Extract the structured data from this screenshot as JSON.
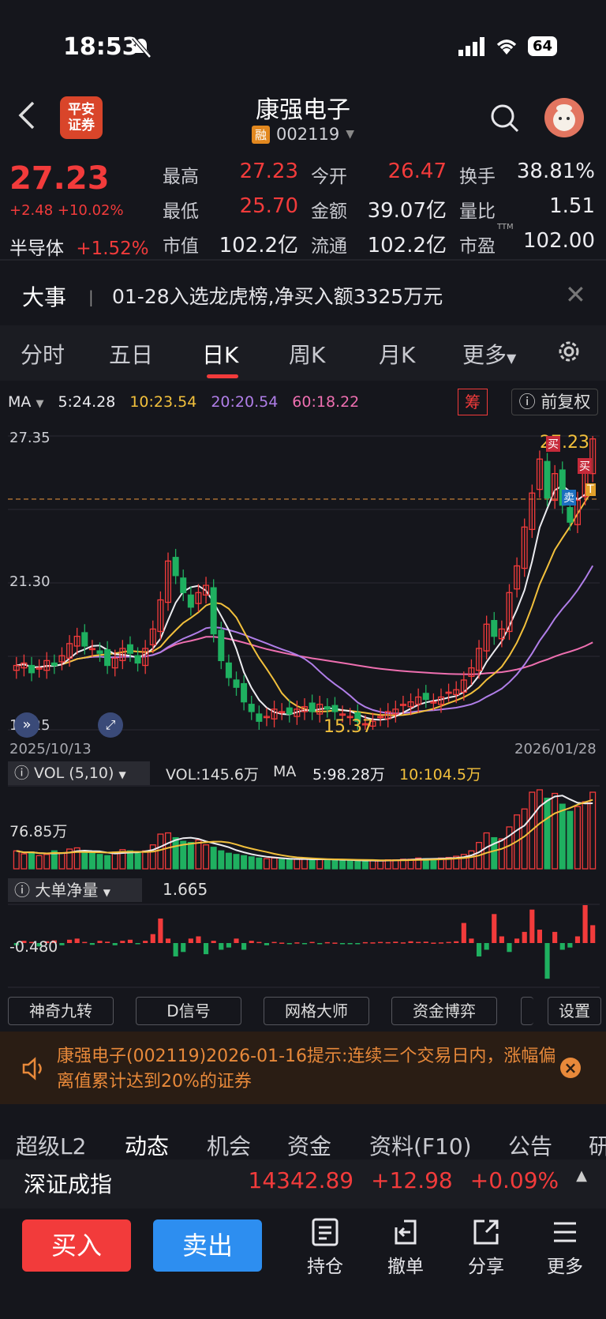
{
  "status": {
    "time": "18:53",
    "battery": "64"
  },
  "header": {
    "title": "康强电子",
    "rong_badge": "融",
    "code": "002119",
    "broker_logo": "平安\n证券"
  },
  "quote": {
    "price": "27.23",
    "change": "+2.48 +10.02%",
    "sector_name": "半导体",
    "sector_change": "+1.52%",
    "fields": [
      {
        "label": "最高",
        "value": "27.23",
        "color": "red"
      },
      {
        "label": "今开",
        "value": "26.47",
        "color": "red"
      },
      {
        "label": "换手",
        "value": "38.81%",
        "color": "white"
      },
      {
        "label": "最低",
        "value": "25.70",
        "color": "red"
      },
      {
        "label": "金额",
        "value": "39.07亿",
        "color": "white"
      },
      {
        "label": "量比",
        "value": "1.51",
        "color": "white"
      },
      {
        "label": "市值",
        "value": "102.2亿",
        "color": "white"
      },
      {
        "label": "流通",
        "value": "102.2亿",
        "color": "white"
      },
      {
        "label": "市盈",
        "value": "102.00",
        "color": "white"
      }
    ],
    "pe_suffix": "TTM"
  },
  "news": {
    "title": "大事",
    "text": "01-28入选龙虎榜,净买入额3325万元"
  },
  "kline_tabs": [
    "分时",
    "五日",
    "日K",
    "周K",
    "月K",
    "更多"
  ],
  "active_tab": "日K",
  "ma": {
    "label": "MA",
    "items": [
      {
        "text": "5:24.28",
        "color": "#ececf0"
      },
      {
        "text": "10:23.54",
        "color": "#f2c03c"
      },
      {
        "text": "20:20.54",
        "color": "#b07ee8"
      },
      {
        "text": "60:18.22",
        "color": "#ee6fb0"
      }
    ],
    "chip_label": "筹",
    "fuquan_label": "前复权"
  },
  "chart_data": {
    "type": "candlestick",
    "y_top_label": "27.35",
    "y_mid_label": "21.30",
    "y_bottom_label": "15.25",
    "ylim": [
      15.25,
      27.35
    ],
    "current_price_line": 24.75,
    "start_date": "2025/10/13",
    "end_date": "2026/01/28",
    "low_annotation": "15.37",
    "high_annotation": "27.23",
    "markers": [
      "买",
      "买",
      "卖",
      "T"
    ],
    "closes": [
      17.9,
      18.0,
      17.6,
      17.8,
      18.1,
      17.9,
      18.3,
      18.8,
      19.1,
      18.7,
      18.6,
      18.4,
      17.9,
      18.2,
      18.6,
      18.4,
      18.0,
      18.6,
      19.4,
      20.6,
      22.2,
      21.6,
      20.9,
      20.3,
      20.9,
      21.2,
      19.2,
      18.1,
      17.4,
      17.0,
      16.4,
      16.0,
      15.6,
      15.8,
      16.1,
      16.0,
      15.9,
      16.1,
      16.2,
      16.0,
      16.3,
      16.1,
      16.0,
      15.9,
      15.8,
      15.6,
      15.5,
      15.6,
      15.8,
      16.0,
      16.1,
      16.3,
      16.4,
      16.6,
      16.5,
      16.4,
      16.6,
      16.8,
      16.9,
      17.3,
      17.8,
      18.6,
      19.6,
      19.1,
      19.4,
      20.9,
      22.0,
      23.6,
      25.0,
      26.4,
      24.8,
      25.8,
      24.5,
      23.8,
      24.7,
      25.9,
      27.23
    ]
  },
  "volume": {
    "label": "VOL (5,10)",
    "vol_text": "VOL:145.6万",
    "ma_label": "MA",
    "ma5": "5:98.28万",
    "ma10": "10:104.5万",
    "axis_label": "76.85万",
    "values": [
      30,
      25,
      28,
      22,
      24,
      30,
      26,
      33,
      35,
      28,
      26,
      24,
      22,
      28,
      32,
      30,
      26,
      30,
      40,
      58,
      60,
      52,
      46,
      44,
      48,
      40,
      36,
      30,
      26,
      24,
      22,
      20,
      18,
      17,
      18,
      16,
      15,
      16,
      17,
      15,
      16,
      15,
      14,
      15,
      14,
      13,
      13,
      14,
      14,
      15,
      15,
      16,
      16,
      18,
      17,
      16,
      18,
      19,
      21,
      24,
      30,
      44,
      60,
      52,
      50,
      70,
      90,
      100,
      128,
      132,
      118,
      126,
      108,
      96,
      104,
      112,
      128
    ]
  },
  "bigorder": {
    "label": "大单净量",
    "value": "1.665",
    "axis_label": "-0.480",
    "values": [
      -0.1,
      0.1,
      0.05,
      -0.15,
      0.08,
      0.12,
      -0.1,
      0.15,
      0.2,
      0.05,
      -0.08,
      0.1,
      0.06,
      -0.1,
      0.1,
      0.15,
      -0.05,
      0.1,
      0.4,
      1.1,
      0.2,
      -0.6,
      -0.4,
      0.2,
      0.3,
      -0.5,
      0.1,
      -0.3,
      -0.2,
      0.2,
      -0.3,
      0.1,
      0.05,
      -0.1,
      0.05,
      0.02,
      -0.05,
      0.03,
      -0.04,
      0.05,
      -0.03,
      0.04,
      0.02,
      -0.05,
      -0.03,
      -0.02,
      0.04,
      0.03,
      0.05,
      0.04,
      0.06,
      0.03,
      0.08,
      0.05,
      0.06,
      0.02,
      0.03,
      0.05,
      0.08,
      0.9,
      0.2,
      -0.6,
      -0.3,
      1.3,
      0.3,
      -0.4,
      0.2,
      0.5,
      1.5,
      0.6,
      -1.6,
      0.5,
      -0.3,
      -0.2,
      0.3,
      1.7,
      0.8
    ]
  },
  "tools": [
    "神奇九转",
    "D信号",
    "网格大师",
    "资金博弈",
    "设置"
  ],
  "notice": {
    "text": "康强电子(002119)2026-01-16提示:连续三个交易日内，涨幅偏离值累计达到20%的证券"
  },
  "bottom_tabs": [
    "超级L2",
    "动态",
    "机会",
    "资金",
    "资料(F10)",
    "公告",
    "研"
  ],
  "active_bottom_tab": "动态",
  "index": {
    "name": "深证成指",
    "value": "14342.89",
    "change": "+12.98",
    "pct": "+0.09%"
  },
  "actions": {
    "buy": "买入",
    "sell": "卖出"
  },
  "nav": [
    {
      "label": "持仓",
      "icon": "position-icon"
    },
    {
      "label": "撤单",
      "icon": "cancel-order-icon"
    },
    {
      "label": "分享",
      "icon": "share-icon"
    },
    {
      "label": "更多",
      "icon": "menu-icon"
    }
  ]
}
